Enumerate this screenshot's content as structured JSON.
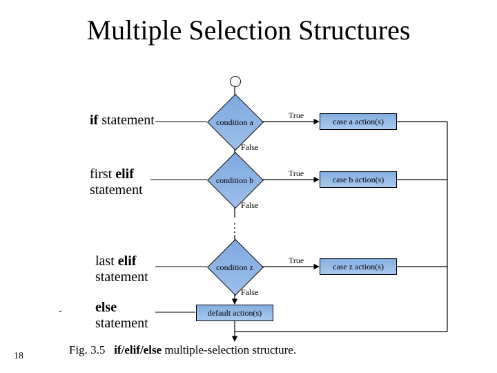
{
  "title": "Multiple Selection Structures",
  "labels": {
    "if_kw": "if",
    "if_rest": " statement",
    "first": "first ",
    "elif_kw": "elif",
    "last": "last ",
    "statement_word": "statement",
    "else_kw": "else"
  },
  "diamonds": {
    "a": "condition a",
    "b": "condition b",
    "z": "condition z"
  },
  "actions": {
    "a": "case a action(s)",
    "b": "case b action(s)",
    "z": "case  z action(s)",
    "default": "default action(s)"
  },
  "edges": {
    "true": "True",
    "false": "False"
  },
  "caption": {
    "fig": "Fig. 3.5",
    "kw": "if/elif/else",
    "rest": " multiple-selection structure."
  },
  "page": "18",
  "chart_data": {
    "type": "flowchart",
    "title": "if/elif/else multiple-selection structure",
    "nodes": [
      {
        "id": "start",
        "kind": "start"
      },
      {
        "id": "cond_a",
        "kind": "decision",
        "text": "condition a",
        "annotation": "if statement"
      },
      {
        "id": "act_a",
        "kind": "process",
        "text": "case a action(s)"
      },
      {
        "id": "cond_b",
        "kind": "decision",
        "text": "condition b",
        "annotation": "first elif statement"
      },
      {
        "id": "act_b",
        "kind": "process",
        "text": "case b action(s)"
      },
      {
        "id": "ellipsis",
        "kind": "continuation"
      },
      {
        "id": "cond_z",
        "kind": "decision",
        "text": "condition z",
        "annotation": "last elif statement"
      },
      {
        "id": "act_z",
        "kind": "process",
        "text": "case z action(s)"
      },
      {
        "id": "default",
        "kind": "process",
        "text": "default action(s)",
        "annotation": "else statement"
      },
      {
        "id": "merge",
        "kind": "merge"
      },
      {
        "id": "end",
        "kind": "end"
      }
    ],
    "edges": [
      {
        "from": "start",
        "to": "cond_a"
      },
      {
        "from": "cond_a",
        "to": "act_a",
        "label": "True"
      },
      {
        "from": "cond_a",
        "to": "cond_b",
        "label": "False"
      },
      {
        "from": "cond_b",
        "to": "act_b",
        "label": "True"
      },
      {
        "from": "cond_b",
        "to": "cond_z",
        "label": "False"
      },
      {
        "from": "cond_z",
        "to": "act_z",
        "label": "True"
      },
      {
        "from": "cond_z",
        "to": "default",
        "label": "False"
      },
      {
        "from": "act_a",
        "to": "merge"
      },
      {
        "from": "act_b",
        "to": "merge"
      },
      {
        "from": "act_z",
        "to": "merge"
      },
      {
        "from": "default",
        "to": "merge"
      },
      {
        "from": "merge",
        "to": "end"
      }
    ]
  }
}
